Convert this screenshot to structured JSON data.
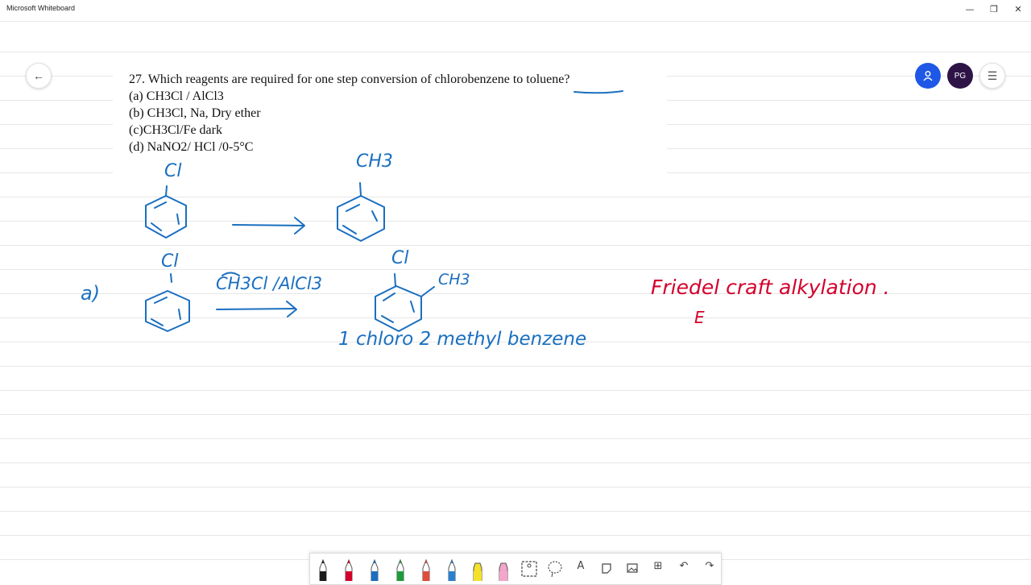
{
  "window": {
    "title": "Microsoft Whiteboard"
  },
  "window_controls": {
    "minimize": "—",
    "restore": "❐",
    "close": "✕"
  },
  "avatar": {
    "initials": "PG"
  },
  "question": {
    "stem": "27. Which reagents are required for one step conversion of chlorobenzene to toluene?",
    "options": [
      {
        "label": "(a)",
        "text": "CH3Cl / AlCl3"
      },
      {
        "label": "(b)",
        "text": "CH3Cl, Na, Dry ether"
      },
      {
        "label": "(c)",
        "text": "CH3Cl/Fe dark"
      },
      {
        "label": "(d)",
        "text": "NaNO2/ HCl /0-5°C"
      }
    ]
  },
  "handwriting": {
    "row1_substituent": "Cl",
    "row1_product_substituent": "CH3",
    "row2_marker": "a)",
    "row2_substituent": "Cl",
    "row2_reagent": "CH3Cl /AlCl3",
    "row2_product_sub1": "Cl",
    "row2_product_sub2": "CH3",
    "product_name": "1 chloro 2 methyl benzene",
    "note": "Friedel craft alkylation .",
    "note_partial": "E"
  },
  "colors": {
    "blue_ink": "#1a6fc0",
    "red_ink": "#d4002c",
    "share": "#1f57e6",
    "avatar": "#2e1446"
  },
  "toolbar_tools": [
    {
      "name": "black-pen",
      "color": "#1b1b1b"
    },
    {
      "name": "red-pen",
      "color": "#d4002c"
    },
    {
      "name": "blue-pen",
      "color": "#1a6fc0"
    },
    {
      "name": "green-pen",
      "color": "#1f9a3a"
    },
    {
      "name": "rainbow-pen",
      "color": "#e24a3a"
    },
    {
      "name": "galaxy-pen",
      "color": "#2a7fd0"
    },
    {
      "name": "yellow-highlighter",
      "color": "#f4e12a"
    },
    {
      "name": "pink-highlighter",
      "color": "#f3a6c9"
    },
    {
      "name": "ruler-tool",
      "icon": "ruler-icon"
    },
    {
      "name": "lasso-tool",
      "icon": "lasso-icon"
    },
    {
      "name": "text-tool",
      "glyph": "A"
    },
    {
      "name": "note-tool",
      "icon": "sticky-note-icon"
    },
    {
      "name": "image-tool",
      "icon": "image-icon"
    },
    {
      "name": "add-tool",
      "glyph": "⊞"
    },
    {
      "name": "undo",
      "glyph": "↶"
    },
    {
      "name": "redo",
      "glyph": "↷"
    }
  ]
}
